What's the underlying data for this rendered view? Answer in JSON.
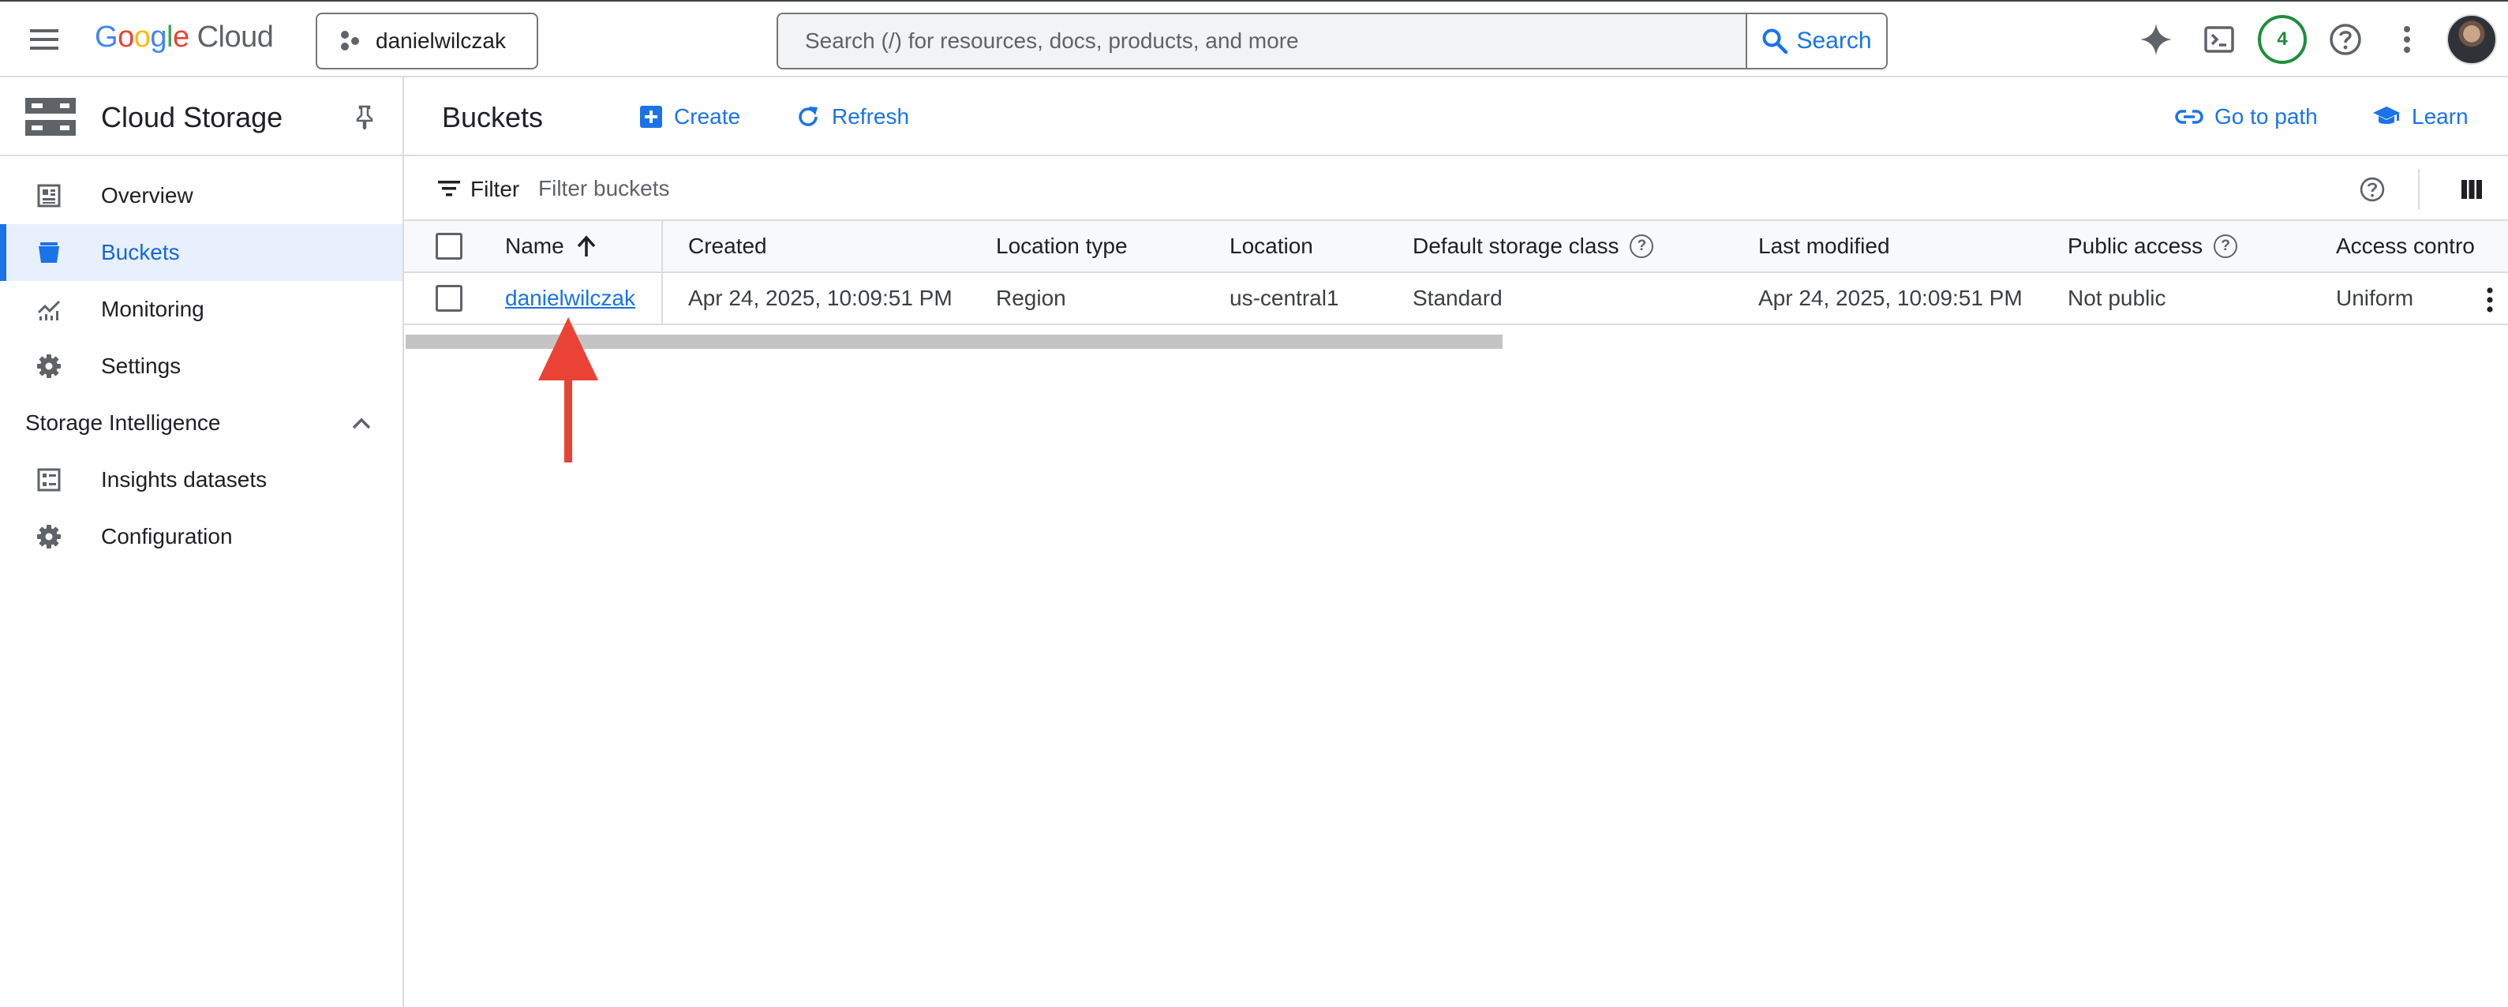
{
  "app": {
    "logo": {
      "g1": "G",
      "g2": "o",
      "g3": "o",
      "g4": "g",
      "g5": "l",
      "g6": "e",
      "product": "Cloud"
    },
    "project": "danielwilczak",
    "search": {
      "placeholder": "Search (/) for resources, docs, products, and more",
      "button": "Search"
    },
    "notifications_count": "4",
    "icons": [
      "menu-icon",
      "project-icon",
      "search-icon",
      "gemini-spark-icon",
      "cloud-shell-icon",
      "help-icon",
      "more-vert-icon",
      "avatar"
    ]
  },
  "sidebar": {
    "product_title": "Cloud Storage",
    "items": [
      {
        "label": "Overview",
        "icon": "overview-icon"
      },
      {
        "label": "Buckets",
        "icon": "bucket-icon",
        "active": true
      },
      {
        "label": "Monitoring",
        "icon": "monitoring-icon"
      },
      {
        "label": "Settings",
        "icon": "gear-icon"
      }
    ],
    "section": {
      "label": "Storage Intelligence",
      "expanded": true,
      "items": [
        {
          "label": "Insights datasets",
          "icon": "dataset-icon"
        },
        {
          "label": "Configuration",
          "icon": "gear-icon"
        }
      ]
    }
  },
  "main": {
    "title": "Buckets",
    "actions": {
      "create": "Create",
      "refresh": "Refresh",
      "go_to_path": "Go to path",
      "learn": "Learn"
    },
    "filter": {
      "label": "Filter",
      "placeholder": "Filter buckets"
    },
    "table": {
      "columns": [
        "Name",
        "Created",
        "Location type",
        "Location",
        "Default storage class",
        "Last modified",
        "Public access",
        "Access contro"
      ],
      "sort": {
        "column": "Name",
        "direction": "ascending"
      },
      "rows": [
        {
          "name": "danielwilczak",
          "created": "Apr 24, 2025, 10:09:51 PM",
          "location_type": "Region",
          "location": "us-central1",
          "storage_class": "Standard",
          "last_modified": "Apr 24, 2025, 10:09:51 PM",
          "public_access": "Not public",
          "access_control": "Uniform"
        }
      ]
    }
  },
  "colors": {
    "accent": "#1a73e8",
    "active_bg": "#e8f0fe",
    "badge_green": "#1e8e3e",
    "annotation_red": "#ea4335"
  }
}
